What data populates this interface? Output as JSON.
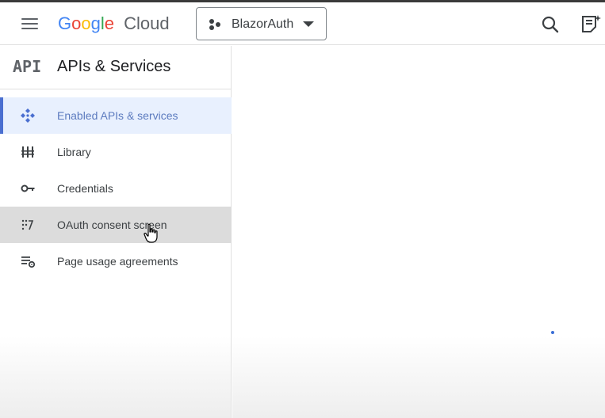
{
  "header": {
    "menu_icon": "hamburger-menu-icon",
    "logo": {
      "google": "Google",
      "cloud": "Cloud"
    },
    "project": {
      "icon": "project-dots-icon",
      "name": "BlazorAuth",
      "caret_icon": "caret-down-icon"
    },
    "actions": [
      {
        "icon": "search-icon"
      },
      {
        "icon": "notes-sparkle-icon"
      }
    ]
  },
  "sidebar": {
    "logo_text": "API",
    "title": "APIs & Services",
    "items": [
      {
        "label": "Enabled APIs & services",
        "icon": "enabled-apis-icon",
        "state": "active"
      },
      {
        "label": "Library",
        "icon": "library-icon",
        "state": "normal"
      },
      {
        "label": "Credentials",
        "icon": "key-icon",
        "state": "normal"
      },
      {
        "label": "OAuth consent screen",
        "icon": "oauth-consent-icon",
        "state": "hover"
      },
      {
        "label": "Page usage agreements",
        "icon": "page-usage-settings-icon",
        "state": "normal"
      }
    ]
  },
  "main": {
    "loading_indicator": "loading-dot"
  },
  "colors": {
    "accent": "#4a6fd0",
    "active_background": "#e8f0fe",
    "hover_background": "#dcdcdc",
    "text": "#3c4043"
  }
}
